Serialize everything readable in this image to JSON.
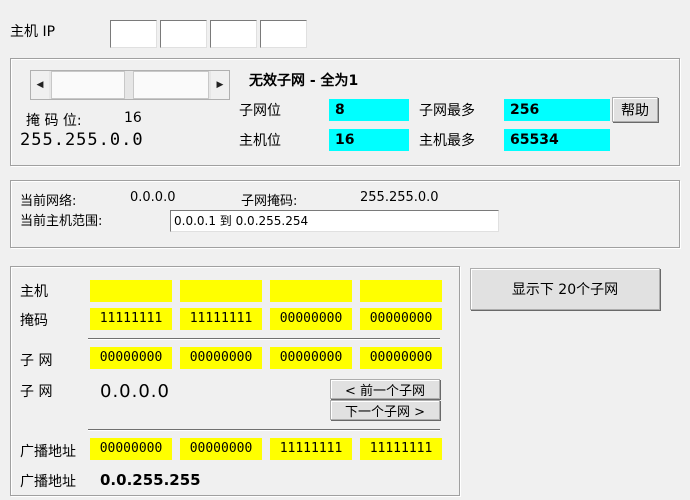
{
  "host_ip": {
    "label": "主机 IP",
    "octets": [
      "",
      "",
      "",
      ""
    ]
  },
  "subnet_config": {
    "mask_bits_label": "掩 码 位:",
    "mask_bits_value": "16",
    "mask_dotted": "255.255.0.0",
    "status_title": "无效子网 - 全为1",
    "subnet_bits_label": "子网位",
    "subnet_bits_value": "8",
    "max_subnets_label": "子网最多",
    "max_subnets_value": "256",
    "host_bits_label": "主机位",
    "host_bits_value": "16",
    "max_hosts_label": "主机最多",
    "max_hosts_value": "65534",
    "help_label": "帮助"
  },
  "current_network": {
    "network_label": "当前网络:",
    "network_value": "0.0.0.0",
    "mask_label": "子网掩码:",
    "mask_value": "255.255.0.0",
    "host_range_label": "当前主机范围:",
    "host_range_value": "0.0.0.1 到 0.0.255.254"
  },
  "binary_view": {
    "host_label": "主机",
    "host_bits": [
      "",
      "",
      "",
      ""
    ],
    "mask_label": "掩码",
    "mask_bits": [
      "11111111",
      "11111111",
      "00000000",
      "00000000"
    ],
    "subnet_label": "子 网",
    "subnet_bits": [
      "00000000",
      "00000000",
      "00000000",
      "00000000"
    ],
    "subnet_dec_label": "子 网",
    "subnet_dec_value": "0.0.0.0",
    "prev_subnet_label": "< 前一个子网",
    "next_subnet_label": "下一个子网 >",
    "broadcast_label": "广播地址",
    "broadcast_bits": [
      "00000000",
      "00000000",
      "11111111",
      "11111111"
    ],
    "broadcast_dec_label": "广播地址",
    "broadcast_dec_value": "0.0.255.255"
  },
  "show_next_subnets_label": "显示下 20个子网",
  "colors": {
    "cyan": "#00ffff",
    "yellow": "#ffff00",
    "background": "#f0f0f0"
  }
}
